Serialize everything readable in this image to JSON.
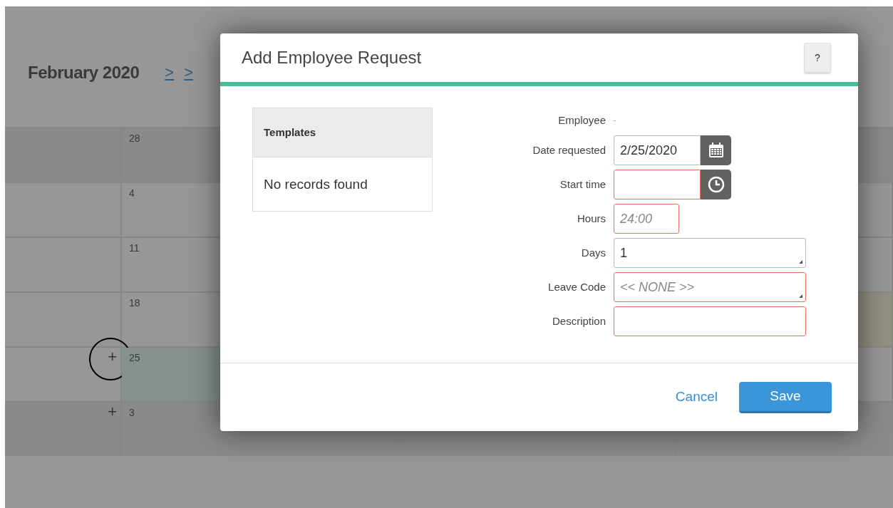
{
  "calendar": {
    "month_title": "February 2020",
    "nav_links": [
      ">",
      ">"
    ],
    "weeks": [
      {
        "day": "28",
        "shaded": true,
        "selected": false,
        "circled": false,
        "tinted": false
      },
      {
        "day": "4",
        "shaded": false,
        "selected": false,
        "circled": false,
        "tinted": false
      },
      {
        "day": "11",
        "shaded": false,
        "selected": false,
        "circled": false,
        "tinted": false
      },
      {
        "day": "18",
        "shaded": false,
        "selected": false,
        "circled": false,
        "tinted": true
      },
      {
        "day": "25",
        "shaded": false,
        "add_label": "+",
        "selected": true,
        "circled": true,
        "tinted": false
      },
      {
        "day": "3",
        "shaded": true,
        "add_label": "+",
        "selected": false,
        "circled": false,
        "tinted": false
      }
    ]
  },
  "dialog": {
    "title": "Add Employee Request",
    "help_button": "?",
    "templates": {
      "heading": "Templates",
      "empty_text": "No records found"
    },
    "fields": [
      {
        "label": "Employee",
        "kind": "static"
      },
      {
        "label": "Date requested",
        "kind": "date",
        "value": "2/25/2020",
        "invalid": false
      },
      {
        "label": "Start time",
        "kind": "time",
        "invalid": true
      },
      {
        "label": "Hours",
        "kind": "short",
        "placeholder": "24:00",
        "invalid": true
      },
      {
        "label": "Days",
        "kind": "select",
        "value": "1",
        "invalid": false
      },
      {
        "label": "Leave Code",
        "kind": "select",
        "placeholder": "<< NONE >>",
        "invalid": true
      },
      {
        "label": "Description",
        "kind": "text",
        "invalid": true
      }
    ],
    "buttons": {
      "cancel": "Cancel",
      "save": "Save"
    }
  }
}
